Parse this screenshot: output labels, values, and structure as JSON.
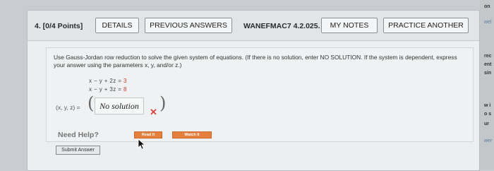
{
  "question": {
    "number_label": "4. [0/4 Points]",
    "reference": "WANEFMAC7 4.2.025."
  },
  "toolbar": {
    "details_label": "DETAILS",
    "previous_answers_label": "PREVIOUS ANSWERS",
    "my_notes_label": "MY NOTES",
    "practice_another_label": "PRACTICE ANOTHER"
  },
  "content": {
    "instructions": "Use Gauss-Jordan row reduction to solve the given system of equations. (If there is no solution, enter NO SOLUTION. If the system is dependent, express your answer using the parameters x, y, and/or z.)",
    "equation1": {
      "lhs": "x − y + 2z =",
      "rhs": "3"
    },
    "equation2": {
      "lhs": "x − y + 3z =",
      "rhs": "8"
    },
    "tuple_label": "(x, y, z) =",
    "answer_value": "No solution",
    "incorrect_mark": "✕"
  },
  "help": {
    "label": "Need Help?",
    "read_it": "Read It",
    "watch_it": "Watch It"
  },
  "submit_label": "Submit Answer",
  "right_strip": [
    "on",
    "wel",
    "rec",
    "ent",
    "sin",
    "w i",
    "o s",
    "ur",
    "wer"
  ],
  "colors": {
    "accent_orange": "#e57f3e",
    "incorrect_red": "#d84040"
  }
}
